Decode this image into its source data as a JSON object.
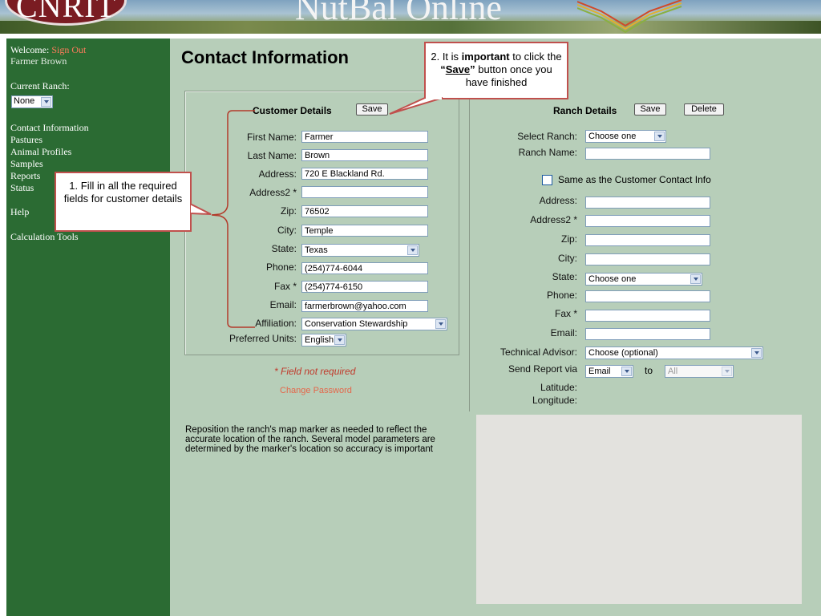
{
  "banner": {
    "logo": "CNRIT",
    "title": "NutBal Online"
  },
  "sidebar": {
    "welcome_label": "Welcome:",
    "sign_out": "Sign Out",
    "user_name": "Farmer Brown",
    "current_ranch_label": "Current Ranch:",
    "current_ranch_value": "None",
    "items": [
      {
        "label": "Contact Information"
      },
      {
        "label": "Pastures"
      },
      {
        "label": "Animal Profiles"
      },
      {
        "label": "Samples"
      },
      {
        "label": "Reports"
      },
      {
        "label": "Status"
      },
      {
        "label": "Help"
      },
      {
        "label": "Calculation Tools"
      }
    ]
  },
  "page_title": "Contact Information",
  "customer": {
    "title": "Customer Details",
    "save": "Save",
    "fields": [
      {
        "label": "First Name:",
        "value": "Farmer"
      },
      {
        "label": "Last Name:",
        "value": "Brown"
      },
      {
        "label": "Address:",
        "value": "720 E Blackland Rd."
      },
      {
        "label": "Address2 *",
        "value": ""
      },
      {
        "label": "Zip:",
        "value": "76502"
      },
      {
        "label": "City:",
        "value": "Temple"
      },
      {
        "label": "State:",
        "value": "Texas"
      },
      {
        "label": "Phone:",
        "value": "(254)774-6044"
      },
      {
        "label": "Fax *",
        "value": "(254)774-6150"
      },
      {
        "label": "Email:",
        "value": "farmerbrown@yahoo.com"
      },
      {
        "label": "Affiliation:",
        "value": "Conservation Stewardship"
      },
      {
        "label": "Preferred Units:",
        "value": "English"
      }
    ],
    "field_not_required": "* Field not required",
    "change_password": "Change Password",
    "reposition_text": "Reposition the ranch's map marker as needed to reflect the accurate location of the ranch. Several model parameters are determined by the marker's location so accuracy is important"
  },
  "ranch": {
    "title": "Ranch Details",
    "save": "Save",
    "delete": "Delete",
    "select_ranch_label": "Select Ranch:",
    "select_ranch_value": "Choose one",
    "ranch_name_label": "Ranch Name:",
    "same_as_label": "Same as the Customer Contact Info",
    "fields": [
      {
        "label": "Address:",
        "value": ""
      },
      {
        "label": "Address2 *",
        "value": ""
      },
      {
        "label": "Zip:",
        "value": ""
      },
      {
        "label": "City:",
        "value": ""
      },
      {
        "label": "State:",
        "value": "Choose one"
      },
      {
        "label": "Phone:",
        "value": ""
      },
      {
        "label": "Fax *",
        "value": ""
      },
      {
        "label": "Email:",
        "value": ""
      }
    ],
    "tech_advisor_label": "Technical Advisor:",
    "tech_advisor_value": "Choose (optional)",
    "send_report_label": "Send Report via",
    "send_report_value": "Email",
    "to_label": "to",
    "to_value": "All",
    "latitude_label": "Latitude:",
    "longitude_label": "Longitude:"
  },
  "callouts": {
    "fill_in": "1.  Fill in all the required fields for customer details",
    "save_pre": "2.  It is ",
    "save_bold": "important",
    "save_mid": " to click the ",
    "save_q_open": "“",
    "save_word": "Save",
    "save_q_close": "”",
    "save_post": " button once you have finished"
  },
  "colors": {
    "sidebar": "#2b6b33",
    "content": "#b7ceb9",
    "callout_border": "#c0504d",
    "link": "#ff7b5c"
  }
}
